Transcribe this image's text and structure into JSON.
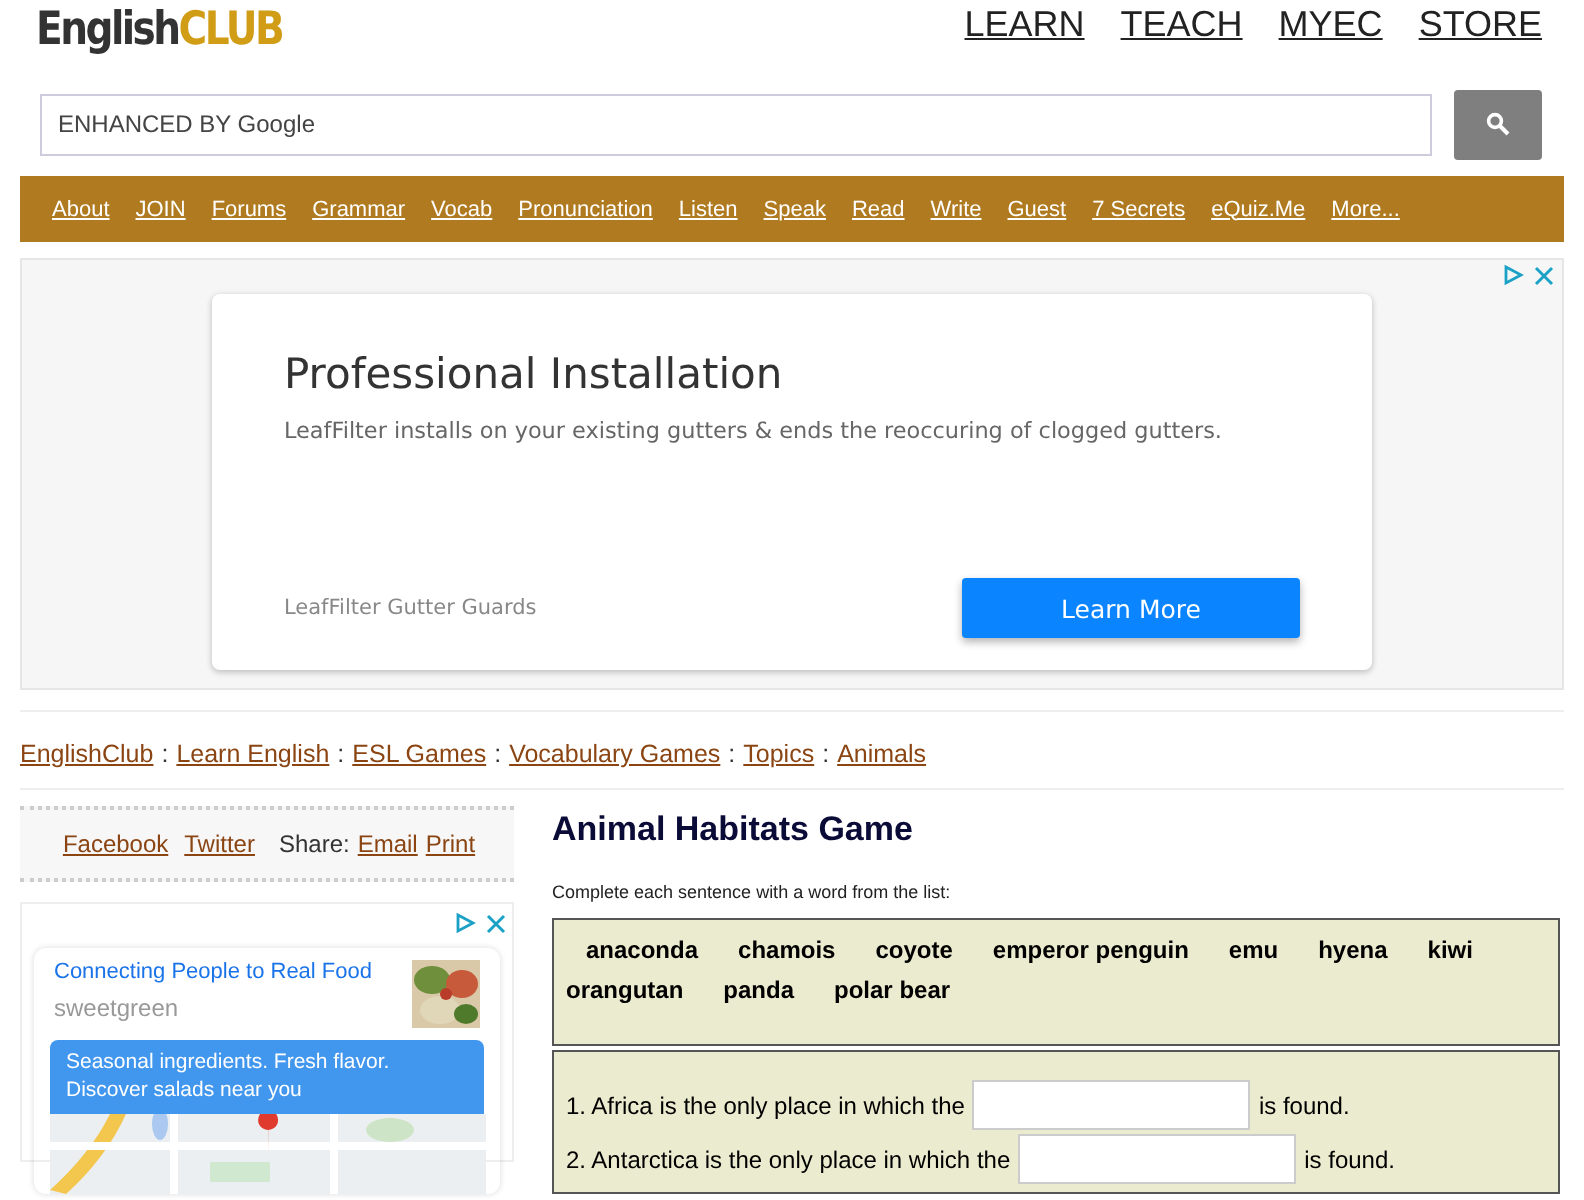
{
  "logo": {
    "part_1": "English",
    "part_2": "CLUB"
  },
  "top_links": [
    "LEARN",
    "TEACH",
    "MYEC",
    "STORE"
  ],
  "search": {
    "placeholder": "ENHANCED BY Google"
  },
  "nav": [
    "About",
    "JOIN",
    "Forums",
    "Grammar",
    "Vocab",
    "Pronunciation",
    "Listen",
    "Speak",
    "Read",
    "Write",
    "Guest",
    "7 Secrets",
    "eQuiz.Me",
    "More..."
  ],
  "ad_banner": {
    "title": "Professional Installation",
    "text": "LeafFilter installs on your existing gutters & ends the reoccuring of clogged gutters.",
    "advertiser": "LeafFilter Gutter Guards",
    "button": "Learn More"
  },
  "breadcrumb": {
    "separator": ":",
    "links": [
      "EnglishClub",
      "Learn English",
      "ESL Games",
      "Vocabulary Games",
      "Topics",
      "Animals"
    ]
  },
  "share": {
    "links": [
      "Facebook",
      "Twitter"
    ],
    "label": "Share:",
    "actions": [
      "Email",
      "Print"
    ]
  },
  "side_ad": {
    "title": "Connecting People to Real Food",
    "advertiser": "sweetgreen",
    "text": "Seasonal ingredients. Fresh flavor. Discover salads near you"
  },
  "game": {
    "title": "Animal Habitats Game",
    "instructions": "Complete each sentence with a word from the list:",
    "words": [
      "anaconda",
      "chamois",
      "coyote",
      "emperor penguin",
      "emu",
      "hyena",
      "kiwi",
      "orangutan",
      "panda",
      "polar bear"
    ],
    "questions": [
      {
        "before": "1. Africa is the only place in which the",
        "after": "is found."
      },
      {
        "before": "2. Antarctica is the only place in which the",
        "after": "is found."
      }
    ]
  }
}
